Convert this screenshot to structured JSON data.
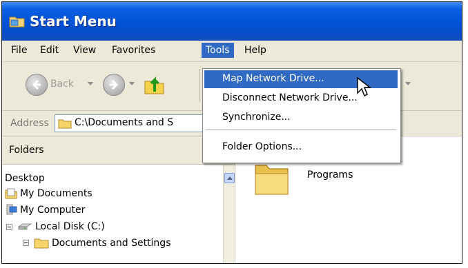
{
  "window": {
    "title": "Start Menu"
  },
  "menubar": {
    "items": [
      "File",
      "Edit",
      "View",
      "Favorites",
      "Tools",
      "Help"
    ],
    "active": "Tools"
  },
  "toolbar": {
    "back_label": "Back",
    "back_icon": "back-arrow-icon",
    "forward_icon": "forward-arrow-icon",
    "up_icon": "up-folder-icon"
  },
  "address": {
    "label": "Address",
    "value": "C:\\Documents and S"
  },
  "folders": {
    "header": "Folders",
    "items": [
      {
        "label": "Desktop",
        "icon": ""
      },
      {
        "label": "My Documents",
        "icon": "my-documents-icon"
      },
      {
        "label": "My Computer",
        "icon": "my-computer-icon"
      },
      {
        "label": "Local Disk (C:)",
        "icon": "drive-icon"
      },
      {
        "label": "Documents and Settings",
        "icon": "folder-icon"
      }
    ]
  },
  "content": {
    "items": [
      {
        "label": "Programs",
        "icon": "folder-icon"
      }
    ]
  },
  "tools_menu": {
    "items": [
      {
        "label": "Map Network Drive...",
        "highlighted": true
      },
      {
        "label": "Disconnect Network Drive...",
        "highlighted": false
      },
      {
        "label": "Synchronize...",
        "highlighted": false
      },
      {
        "label": "Folder Options...",
        "highlighted": false
      }
    ]
  },
  "colors": {
    "titlebar": "#0052d6",
    "menu_highlight": "#316ac5",
    "chrome": "#ece9d8"
  }
}
